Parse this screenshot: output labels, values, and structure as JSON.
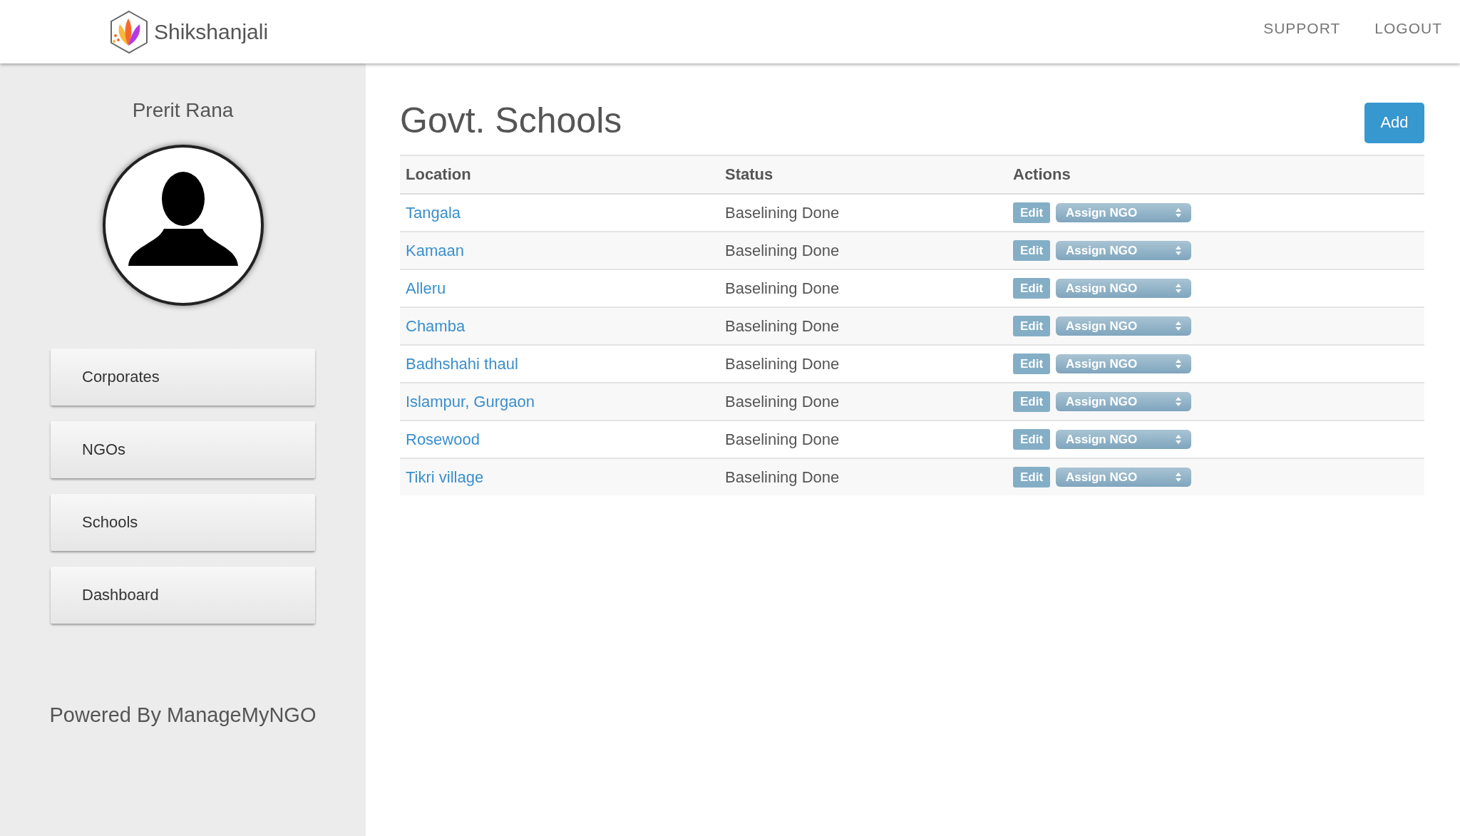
{
  "header": {
    "brand": "Shikshanjali",
    "nav": [
      "SUPPORT",
      "LOGOUT"
    ]
  },
  "sidebar": {
    "user_name": "Prerit Rana",
    "items": [
      "Corporates",
      "NGOs",
      "Schools",
      "Dashboard"
    ],
    "footer": "Powered By ManageMyNGO"
  },
  "page": {
    "title": "Govt. Schools",
    "add_button": "Add"
  },
  "table": {
    "columns": [
      "Location",
      "Status",
      "Actions"
    ],
    "rows": [
      {
        "location": "Tangala",
        "status": "Baselining Done",
        "edit": "Edit",
        "assign": "Assign NGO"
      },
      {
        "location": "Kamaan",
        "status": "Baselining Done",
        "edit": "Edit",
        "assign": "Assign NGO"
      },
      {
        "location": "Alleru",
        "status": "Baselining Done",
        "edit": "Edit",
        "assign": "Assign NGO"
      },
      {
        "location": "Chamba",
        "status": "Baselining Done",
        "edit": "Edit",
        "assign": "Assign NGO"
      },
      {
        "location": "Badhshahi thaul",
        "status": "Baselining Done",
        "edit": "Edit",
        "assign": "Assign NGO"
      },
      {
        "location": "Islampur, Gurgaon",
        "status": "Baselining Done",
        "edit": "Edit",
        "assign": "Assign NGO"
      },
      {
        "location": "Rosewood",
        "status": "Baselining Done",
        "edit": "Edit",
        "assign": "Assign NGO"
      },
      {
        "location": "Tikri village",
        "status": "Baselining Done",
        "edit": "Edit",
        "assign": "Assign NGO"
      }
    ]
  }
}
